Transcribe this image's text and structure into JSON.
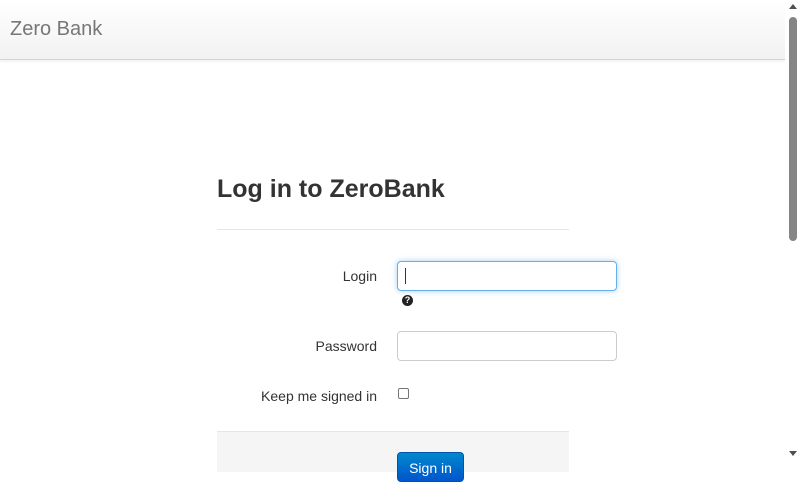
{
  "navbar": {
    "brand": "Zero Bank"
  },
  "login_form": {
    "title": "Log in to ZeroBank",
    "login_label": "Login",
    "login_value": "",
    "password_label": "Password",
    "password_value": "",
    "keep_signed_in_label": "Keep me signed in",
    "keep_signed_in_checked": false,
    "help_icon": "question-circle-icon",
    "submit_label": "Sign in"
  },
  "colors": {
    "focus_border": "#66afe9",
    "button_blue": "#0055cc"
  }
}
